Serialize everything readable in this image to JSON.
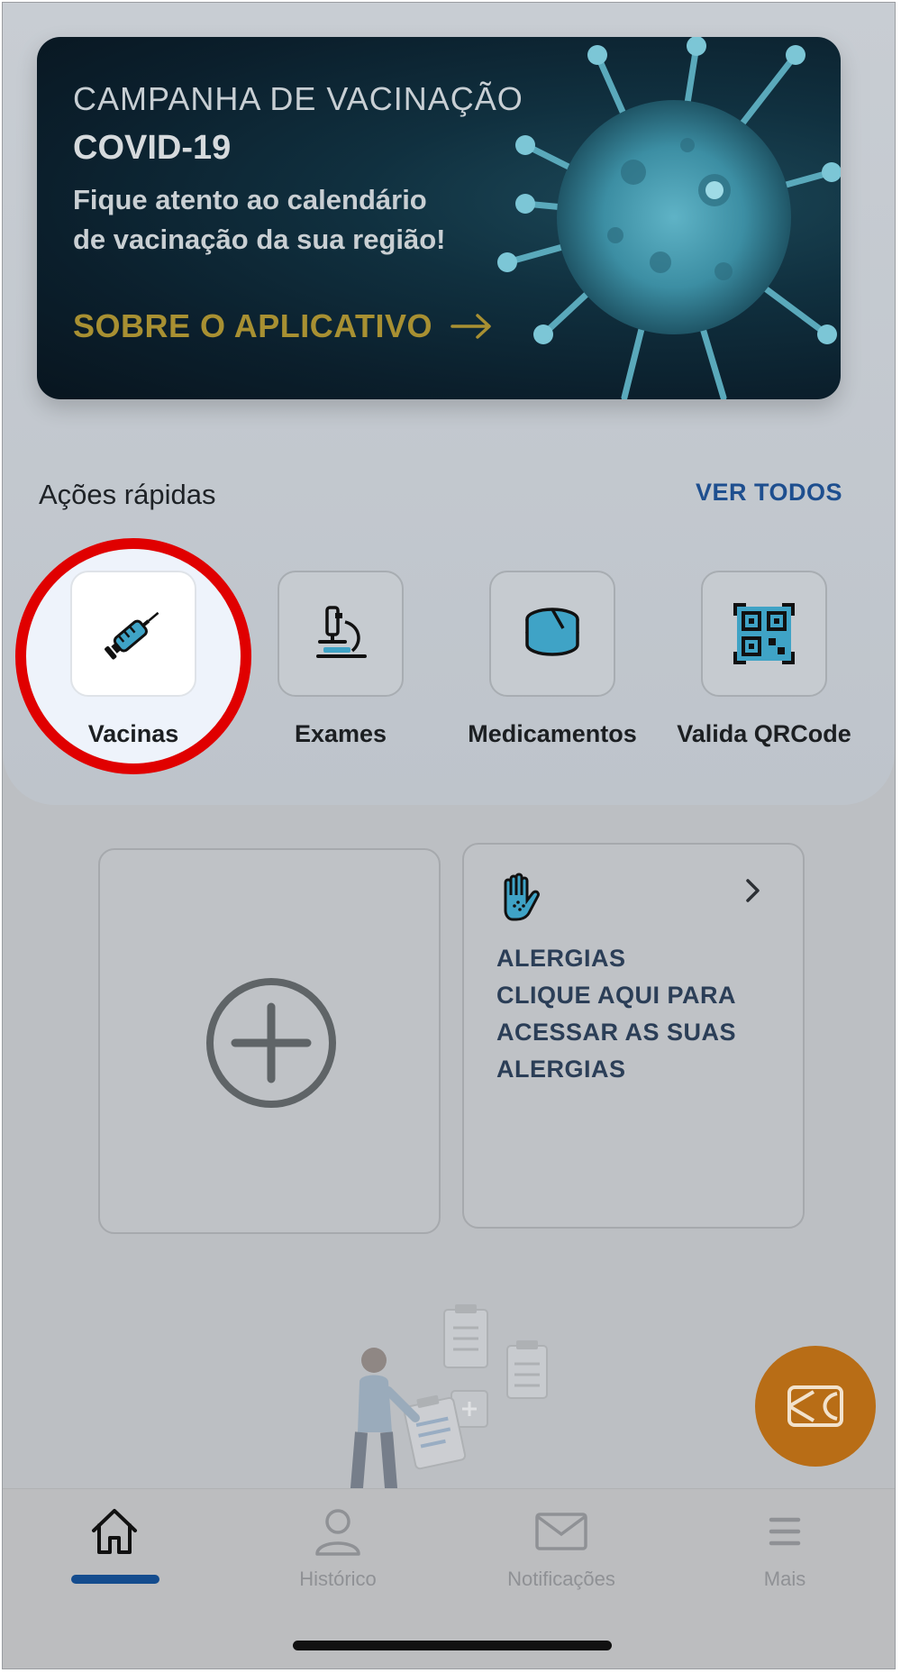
{
  "banner": {
    "campaign": "CAMPANHA DE VACINAÇÃO",
    "title": "COVID-19",
    "line1": "Fique atento ao calendário",
    "line2": "de vacinação da sua região!",
    "cta": "SOBRE O APLICATIVO",
    "cta_icon": "arrow-right-icon"
  },
  "quick_actions": {
    "title": "Ações rápidas",
    "see_all": "VER TODOS",
    "items": [
      {
        "label": "Vacinas",
        "icon": "syringe-icon",
        "highlighted": true
      },
      {
        "label": "Exames",
        "icon": "microscope-icon"
      },
      {
        "label": "Medicamentos",
        "icon": "pill-icon"
      },
      {
        "label": "Valida QRCode",
        "icon": "qrcode-icon"
      }
    ]
  },
  "cards": {
    "add": {
      "icon": "plus-circle-icon"
    },
    "allergy": {
      "icon": "hand-icon",
      "title": "ALERGIAS",
      "line1": "CLIQUE AQUI PARA",
      "line2": "ACESSAR AS SUAS",
      "line3": "ALERGIAS"
    }
  },
  "fab": {
    "icon": "card-logo-icon"
  },
  "bottom_nav": {
    "items": [
      {
        "label": "",
        "icon": "home-icon",
        "active": true
      },
      {
        "label": "Histórico",
        "icon": "person-icon"
      },
      {
        "label": "Notificações",
        "icon": "mail-icon"
      },
      {
        "label": "Mais",
        "icon": "menu-icon"
      }
    ]
  },
  "colors": {
    "accent_blue": "#1e4f8f",
    "highlight_red": "#e00000",
    "gold": "#a89032",
    "fab_orange": "#b86d16"
  }
}
